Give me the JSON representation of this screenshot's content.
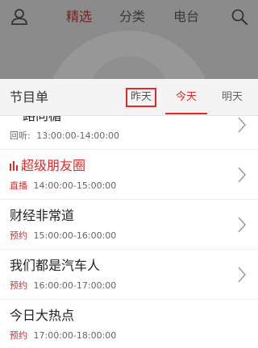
{
  "nav": {
    "tabs": [
      {
        "label": "精选",
        "active": true
      },
      {
        "label": "分类",
        "active": false
      },
      {
        "label": "电台",
        "active": false
      }
    ],
    "left_icon": "user-icon",
    "right_icon": "search-icon"
  },
  "schedule": {
    "title": "节目单",
    "days": {
      "yesterday": "昨天",
      "today": "今天",
      "tomorrow": "明天"
    },
    "items": [
      {
        "name": "一路向楣",
        "status": "回听:",
        "time": "13:00:00-14:00:00"
      },
      {
        "name": "超级朋友圈",
        "status": "直播",
        "time": "14:00:00-15:00:00"
      },
      {
        "name": "财经非常道",
        "status": "预约",
        "time": "15:00:00-16:00:00"
      },
      {
        "name": "我们都是汽车人",
        "status": "预约",
        "time": "16:00:00-17:00:00"
      },
      {
        "name": "今日大热点",
        "status": "预约",
        "time": "17:00:00-18:00:00"
      }
    ]
  },
  "colors": {
    "accent": "#e02a2a",
    "nav_active": "#7a1f1f",
    "header_bg": "#8b8b8b"
  }
}
